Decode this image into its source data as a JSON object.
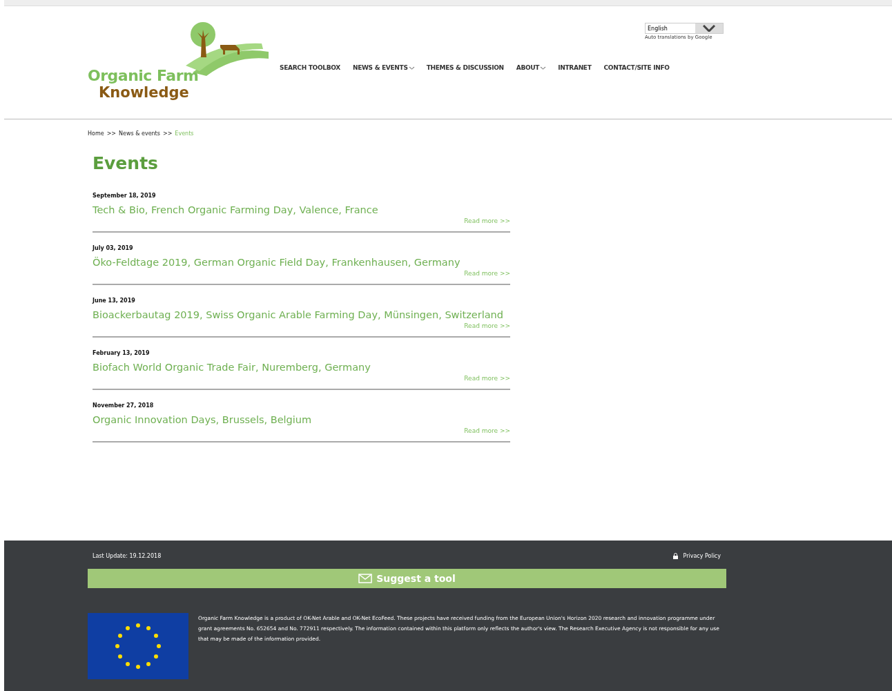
{
  "logo": {
    "line_1": "Organic Farm",
    "line_2": "Knowledge"
  },
  "language": {
    "value": "English",
    "note": "Auto translations by Google"
  },
  "nav": [
    {
      "label": "SEARCH TOOLBOX",
      "dropdown": false
    },
    {
      "label": "NEWS & EVENTS",
      "dropdown": true
    },
    {
      "label": "THEMES & DISCUSSION",
      "dropdown": false
    },
    {
      "label": "ABOUT",
      "dropdown": true
    },
    {
      "label": "INTRANET",
      "dropdown": false
    },
    {
      "label": "CONTACT/SITE INFO",
      "dropdown": false
    }
  ],
  "breadcrumb": [
    {
      "label": "Home",
      "current": false
    },
    {
      "label": "News & events",
      "current": false
    },
    {
      "label": "Events",
      "current": true
    }
  ],
  "breadcrumb_separator": ">>",
  "heading": "Events",
  "events": [
    {
      "date": "September 18, 2019",
      "title": "Tech & Bio, French Organic Farming Day, Valence, France",
      "link": "Read more >>"
    },
    {
      "date": "July 03, 2019",
      "title": "Öko-Feldtage 2019, German Organic Field Day, Frankenhausen, Germany",
      "link": "Read more >>"
    },
    {
      "date": "June 13, 2019",
      "title": "Bioackerbautag 2019, Swiss Organic Arable Farming Day, Münsingen, Switzerland",
      "link": "Read more >>"
    },
    {
      "date": "February 13, 2019",
      "title": "Biofach World Organic Trade Fair, Nuremberg, Germany",
      "link": "Read more >>"
    },
    {
      "date": "November 27, 2018",
      "title": "Organic Innovation Days, Brussels, Belgium",
      "link": "Read more >>"
    }
  ],
  "footer": {
    "last_update": "Last Update: 19.12.2018",
    "privacy": "Privacy Policy",
    "suggest_button": "Suggest a tool",
    "disclaimer": "Organic Farm Knowledge is a product of OK-Net Arable and OK-Net EcoFeed. These projects have received funding from the European Union's Horizon 2020 research and innovation programme under grant agreements No. 652654 and No. 772911 respectively. The information contained within this platform only reflects the author's view. The Research Executive Agency is not responsible for any use that may be made of the information provided."
  }
}
